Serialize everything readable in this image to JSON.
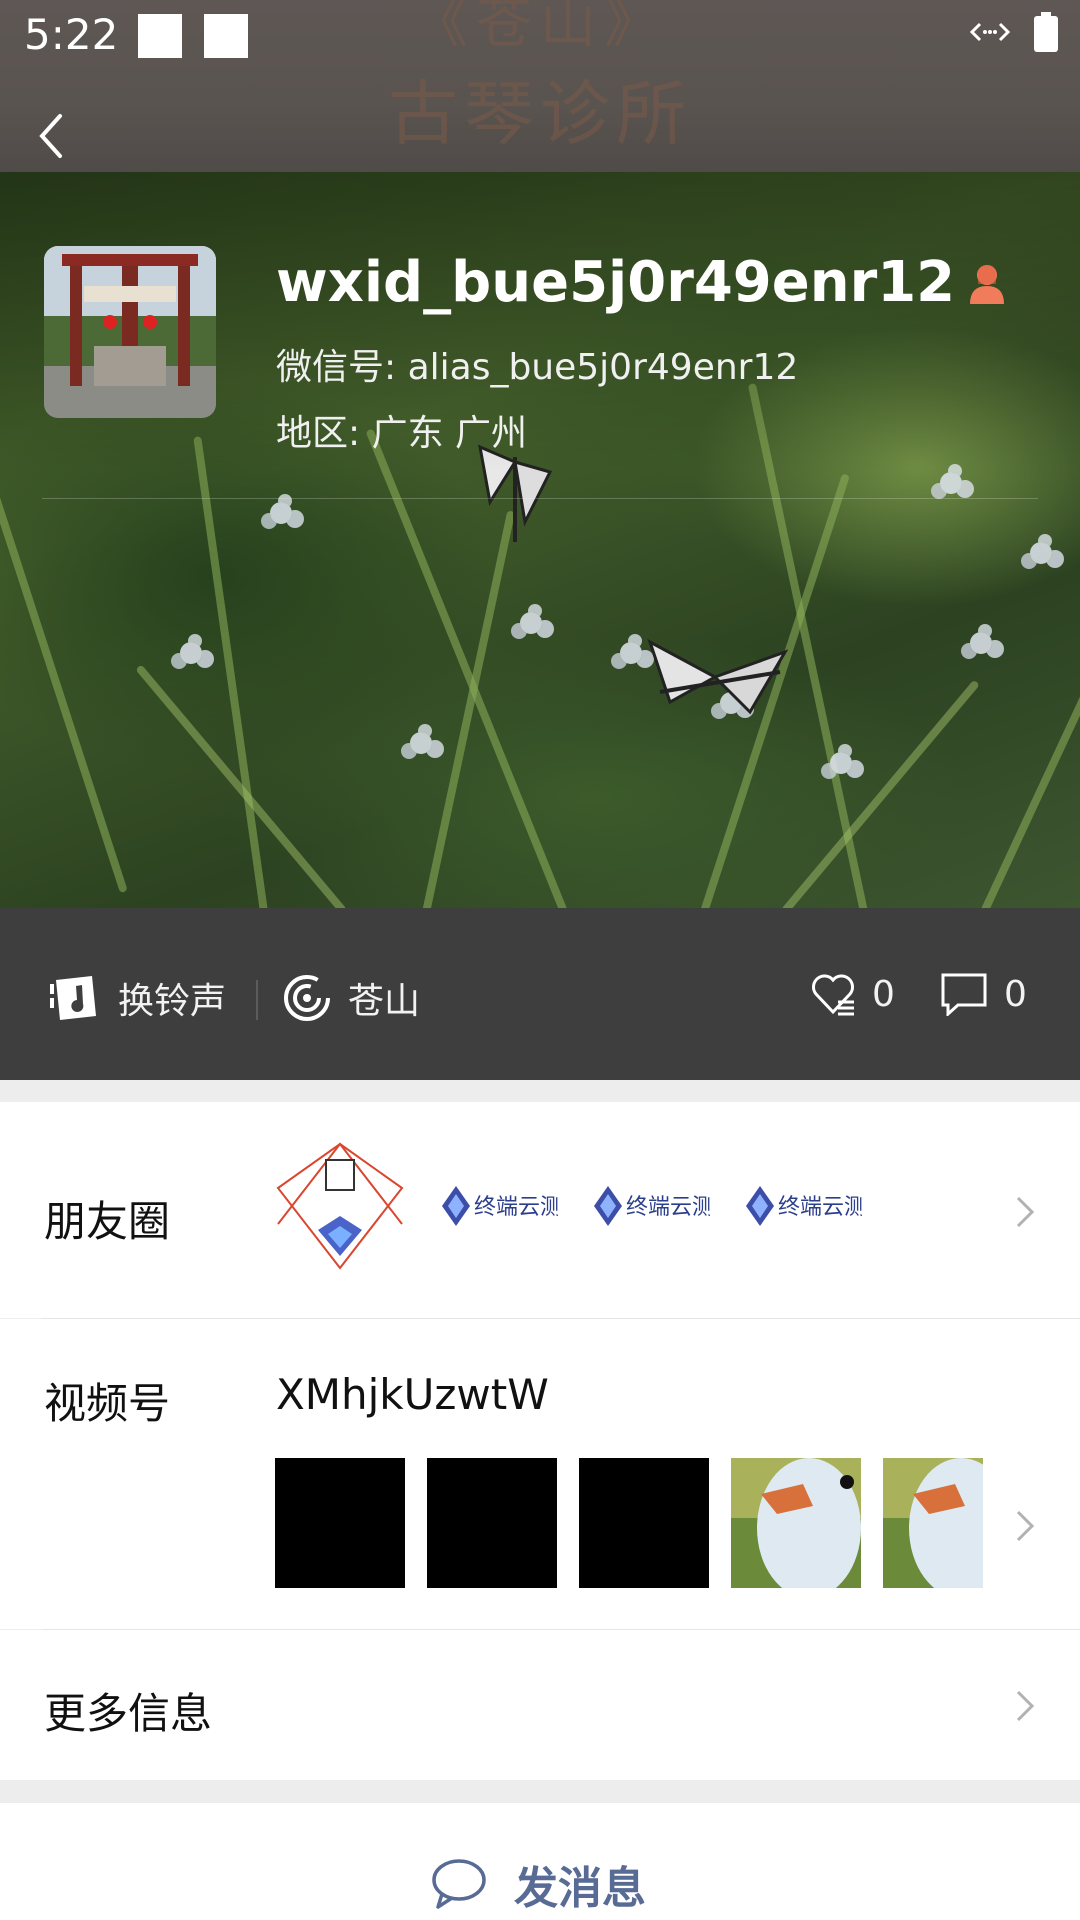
{
  "status_bar": {
    "time": "5:22"
  },
  "header": {
    "cover_text_1": "《苍山》",
    "cover_text_2": "古琴诊所"
  },
  "profile": {
    "name": "wxid_bue5j0r49enr12",
    "wechat_id": "微信号: alias_bue5j0r49enr12",
    "region": "地区: 广东  广州",
    "gender_icon": "female-icon"
  },
  "status_strip": {
    "ringtone_label": "换铃声",
    "status_label": "苍山",
    "likes": "0",
    "comments": "0"
  },
  "moments": {
    "label": "朋友圈"
  },
  "channels": {
    "label": "视频号",
    "name": "XMhjkUzwtW"
  },
  "more_info": {
    "label": "更多信息"
  },
  "actions": {
    "send_message": "发消息"
  },
  "colors": {
    "link": "#576b95",
    "status_bg": "#3f3e3e",
    "female": "#f07c5c"
  }
}
